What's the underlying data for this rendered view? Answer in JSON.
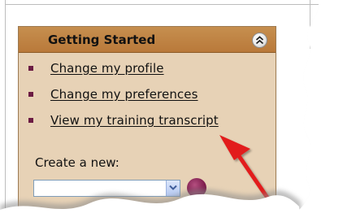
{
  "panel": {
    "title": "Getting Started",
    "collapse_icon": "double-chevron-up-icon"
  },
  "menu": {
    "items": [
      {
        "label": "Change my profile"
      },
      {
        "label": "Change my preferences"
      },
      {
        "label": "View my training transcript"
      }
    ]
  },
  "create": {
    "label": "Create a new:"
  },
  "colors": {
    "header": "#b9793a",
    "panel_bg": "#e7d2b6",
    "bullet": "#6b1b43",
    "arrow": "#e21a1a"
  },
  "annotation": {
    "icon": "red-arrow-icon"
  }
}
